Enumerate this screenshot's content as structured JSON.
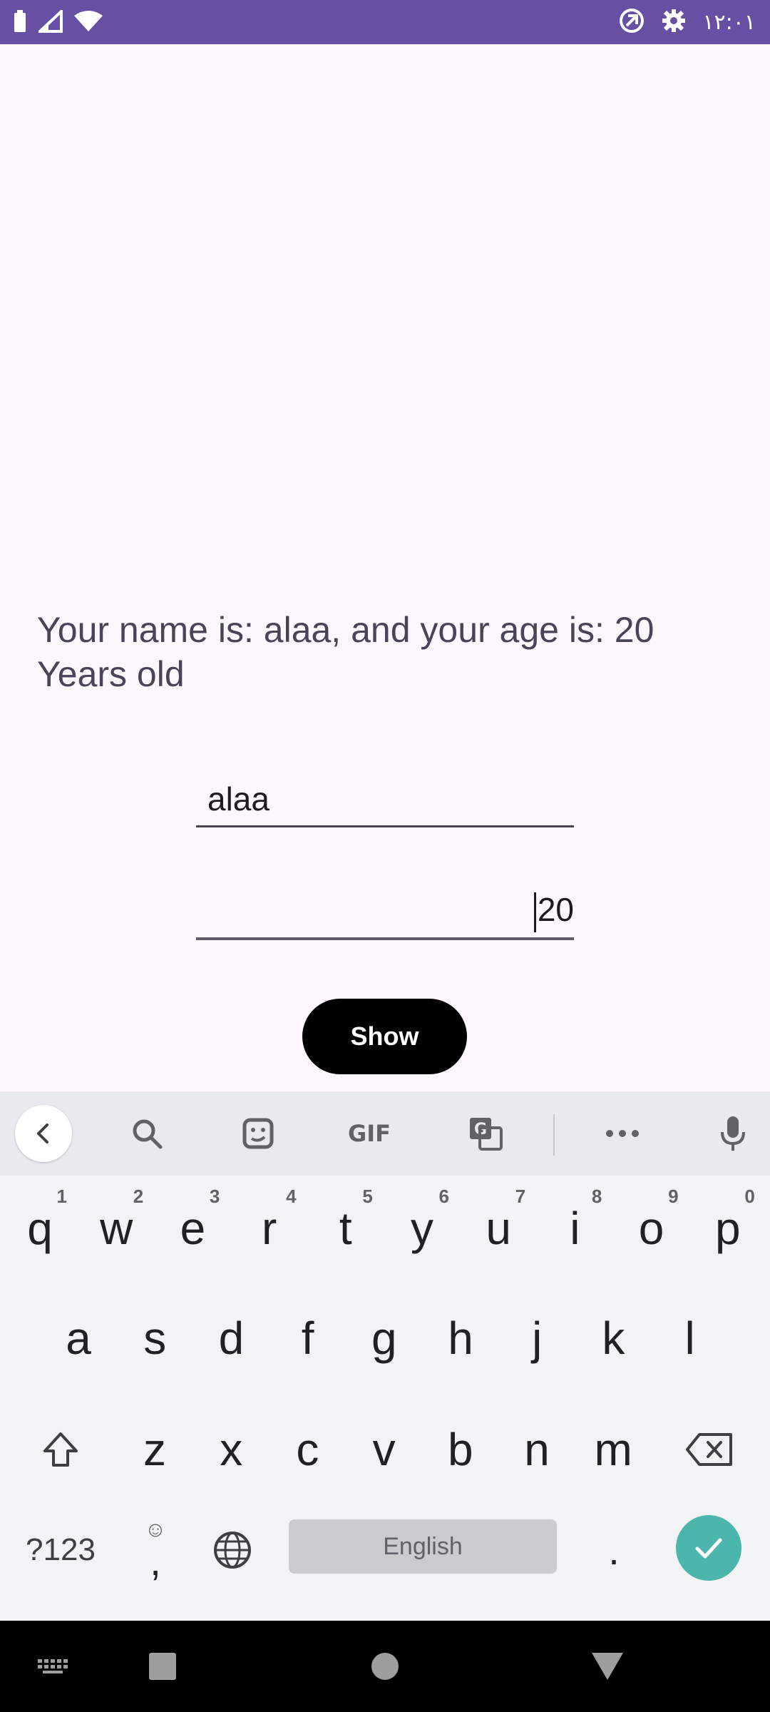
{
  "status_bar": {
    "time": "١٢:٠١",
    "icons": [
      "battery-icon",
      "signal-icon",
      "wifi-icon",
      "sync-icon",
      "settings-icon"
    ],
    "background_color": "#6750a4"
  },
  "app": {
    "result_text": "Your name is: alaa, and your age is: 20 Years old",
    "name_field": {
      "value": "alaa"
    },
    "age_field": {
      "value": "20"
    },
    "show_button": {
      "label": "Show"
    }
  },
  "keyboard": {
    "toolbar": {
      "icons": [
        "back-icon",
        "search-icon",
        "sticker-icon",
        "gif-icon",
        "translate-icon",
        "more-icon",
        "mic-icon"
      ],
      "gif_label": "GIF"
    },
    "row1": [
      {
        "key": "q",
        "hint": "1"
      },
      {
        "key": "w",
        "hint": "2"
      },
      {
        "key": "e",
        "hint": "3"
      },
      {
        "key": "r",
        "hint": "4"
      },
      {
        "key": "t",
        "hint": "5"
      },
      {
        "key": "y",
        "hint": "6"
      },
      {
        "key": "u",
        "hint": "7"
      },
      {
        "key": "i",
        "hint": "8"
      },
      {
        "key": "o",
        "hint": "9"
      },
      {
        "key": "p",
        "hint": "0"
      }
    ],
    "row2": [
      "a",
      "s",
      "d",
      "f",
      "g",
      "h",
      "j",
      "k",
      "l"
    ],
    "row3": [
      "z",
      "x",
      "c",
      "v",
      "b",
      "n",
      "m"
    ],
    "symbols_label": "?123",
    "comma_label": ",",
    "emoji_hint": "☺",
    "space_label": "English",
    "period_label": ".",
    "enter_color": "#4db6ac"
  },
  "nav_bar": {
    "icons": [
      "keyboard-switch-icon",
      "recents-icon",
      "home-icon",
      "back-icon"
    ]
  }
}
